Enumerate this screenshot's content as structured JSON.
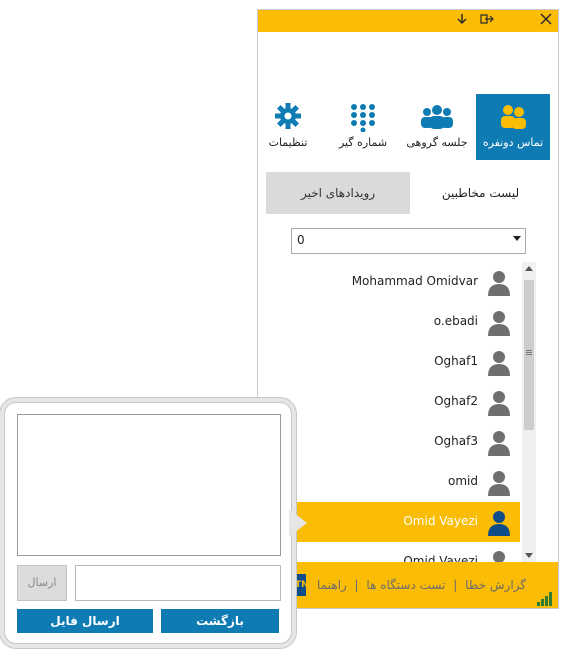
{
  "window": {
    "title_buttons": {
      "close": "close-icon",
      "minimize": "arrow-down-icon",
      "logout": "logout-icon"
    }
  },
  "nav": {
    "items": [
      {
        "label": "تماس دونفره",
        "icon": "two-users-icon",
        "active": true
      },
      {
        "label": "جلسه گروهی",
        "icon": "group-icon",
        "active": false
      },
      {
        "label": "شماره گیر",
        "icon": "dialpad-icon",
        "active": false
      },
      {
        "label": "تنظیمات",
        "icon": "gear-icon",
        "active": false
      }
    ]
  },
  "tabs": {
    "contacts": "لیست مخاطبین",
    "recent": "رویدادهای اخیر"
  },
  "filter": {
    "value": "0"
  },
  "contacts": [
    {
      "name": "Mohammad Omidvar",
      "selected": false
    },
    {
      "name": "o.ebadi",
      "selected": false
    },
    {
      "name": "Oghaf1",
      "selected": false
    },
    {
      "name": "Oghaf2",
      "selected": false
    },
    {
      "name": "Oghaf3",
      "selected": false
    },
    {
      "name": "omid",
      "selected": false
    },
    {
      "name": "Omid Vayezi",
      "selected": true
    },
    {
      "name": "Omid Vayezi",
      "selected": false
    }
  ],
  "footer": {
    "help": "راهنما",
    "device_test": "تست دستگاه ها",
    "error_report": "گزارش خطا",
    "sep": "|",
    "logo_text": "MTN"
  },
  "chat": {
    "send_label": "ارسال",
    "send_file_label": "ارسال فایل",
    "back_label": "بازگشت",
    "message_value": ""
  },
  "colors": {
    "accent_yellow": "#fbbc05",
    "accent_blue": "#0f7bb3",
    "avatar_gray": "#6f6f6f",
    "avatar_selected": "#0f4c8a"
  }
}
